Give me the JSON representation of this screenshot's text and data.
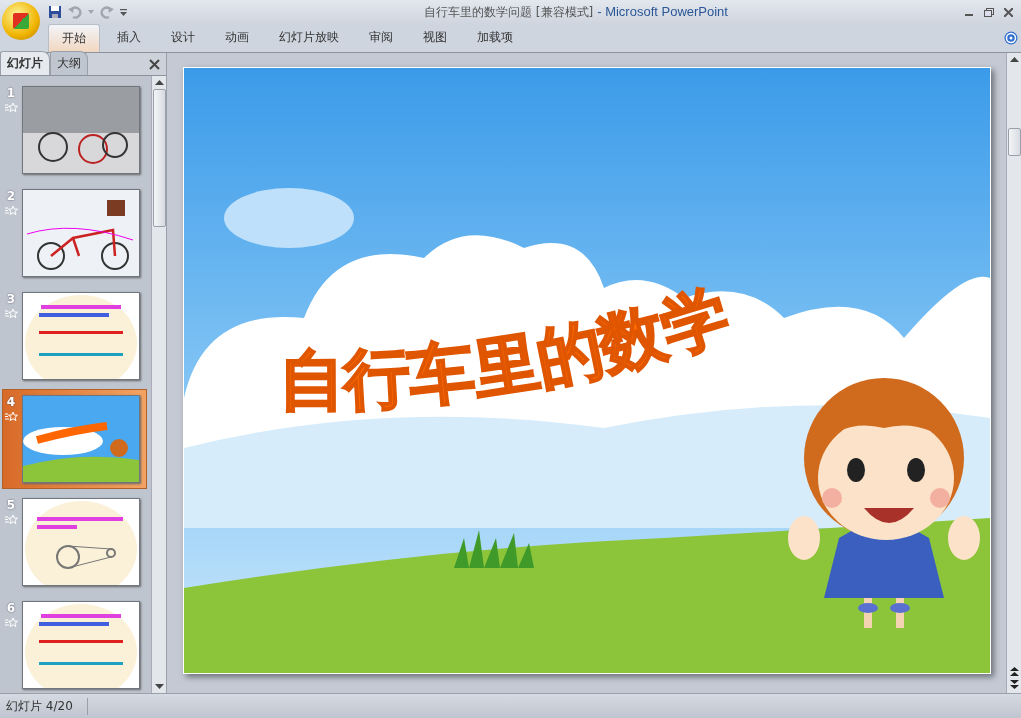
{
  "window": {
    "document_title": "自行车里的数学问题 [兼容模式]",
    "app_title": "- Microsoft PowerPoint"
  },
  "ribbon_tabs": [
    {
      "label": "开始",
      "selected": true
    },
    {
      "label": "插入",
      "selected": false
    },
    {
      "label": "设计",
      "selected": false
    },
    {
      "label": "动画",
      "selected": false
    },
    {
      "label": "幻灯片放映",
      "selected": false
    },
    {
      "label": "审阅",
      "selected": false
    },
    {
      "label": "视图",
      "selected": false
    },
    {
      "label": "加载项",
      "selected": false
    }
  ],
  "panel_tabs": [
    {
      "label": "幻灯片",
      "selected": true
    },
    {
      "label": "大纲",
      "selected": false
    }
  ],
  "slides": [
    {
      "number": "1",
      "kind": "photo",
      "animated": true,
      "selected": false
    },
    {
      "number": "2",
      "kind": "diagram",
      "animated": true,
      "selected": false
    },
    {
      "number": "3",
      "kind": "text",
      "animated": true,
      "selected": false
    },
    {
      "number": "4",
      "kind": "title",
      "animated": true,
      "selected": true
    },
    {
      "number": "5",
      "kind": "chain",
      "animated": true,
      "selected": false
    },
    {
      "number": "6",
      "kind": "text",
      "animated": true,
      "selected": false
    }
  ],
  "current_slide": {
    "title": "自行车里的数学"
  },
  "status_bar": {
    "slide_indicator": "幻灯片 4/20"
  }
}
